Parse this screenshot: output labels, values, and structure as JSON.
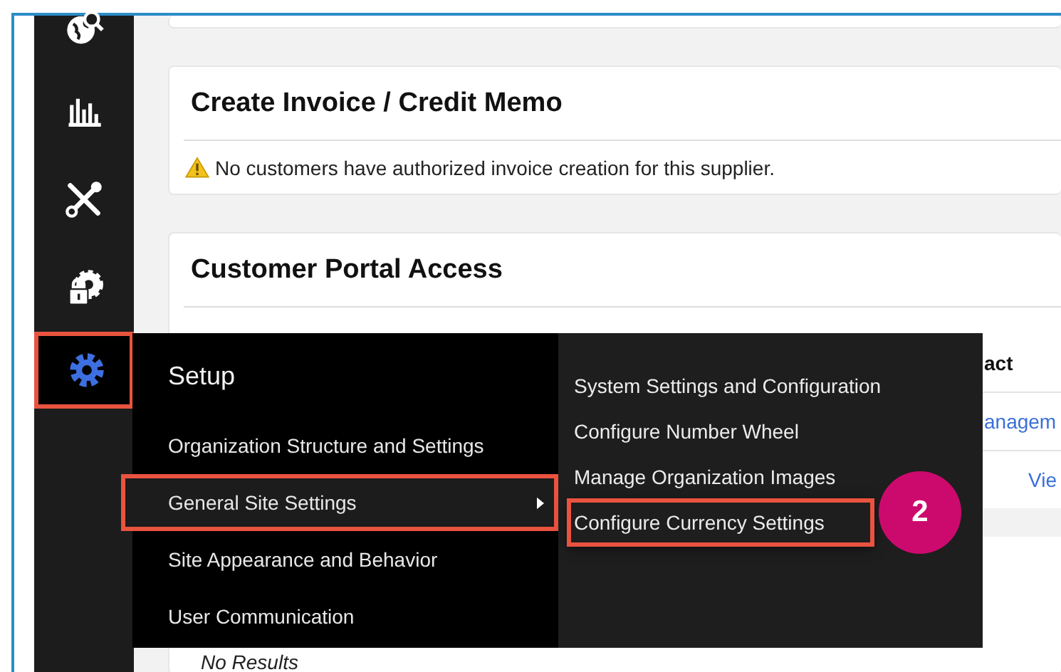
{
  "sidebar": {
    "items": [
      {
        "kind": "globe-search",
        "selected": false,
        "annotated": false
      },
      {
        "kind": "bar-chart",
        "selected": false,
        "annotated": false
      },
      {
        "kind": "tools",
        "selected": false,
        "annotated": false
      },
      {
        "kind": "lock-gear",
        "selected": false,
        "annotated": false
      },
      {
        "kind": "gear",
        "selected": true,
        "annotated": true
      }
    ]
  },
  "invoice_card": {
    "title": "Create Invoice / Credit Memo",
    "warning": "No customers have authorized invoice creation for this supplier."
  },
  "portal_card": {
    "title": "Customer Portal Access",
    "column_3": "act",
    "link": "anagem",
    "view_link": "Vie",
    "empty_text": "No Results"
  },
  "menu": {
    "title": "Setup",
    "items": [
      {
        "label": "Organization Structure and Settings",
        "selected": false,
        "has_submenu": false,
        "annotated": false
      },
      {
        "label": "General Site Settings",
        "selected": true,
        "has_submenu": true,
        "annotated": true
      },
      {
        "label": "Site Appearance and Behavior",
        "selected": false,
        "has_submenu": false,
        "annotated": false
      },
      {
        "label": "User Communication",
        "selected": false,
        "has_submenu": false,
        "annotated": false
      }
    ],
    "submenu": [
      {
        "label": "System Settings and Configuration",
        "annotated": false
      },
      {
        "label": "Configure Number Wheel",
        "annotated": false
      },
      {
        "label": "Manage Organization Images",
        "annotated": false
      },
      {
        "label": "Configure Currency Settings",
        "annotated": true
      }
    ]
  },
  "step_badge": "2"
}
